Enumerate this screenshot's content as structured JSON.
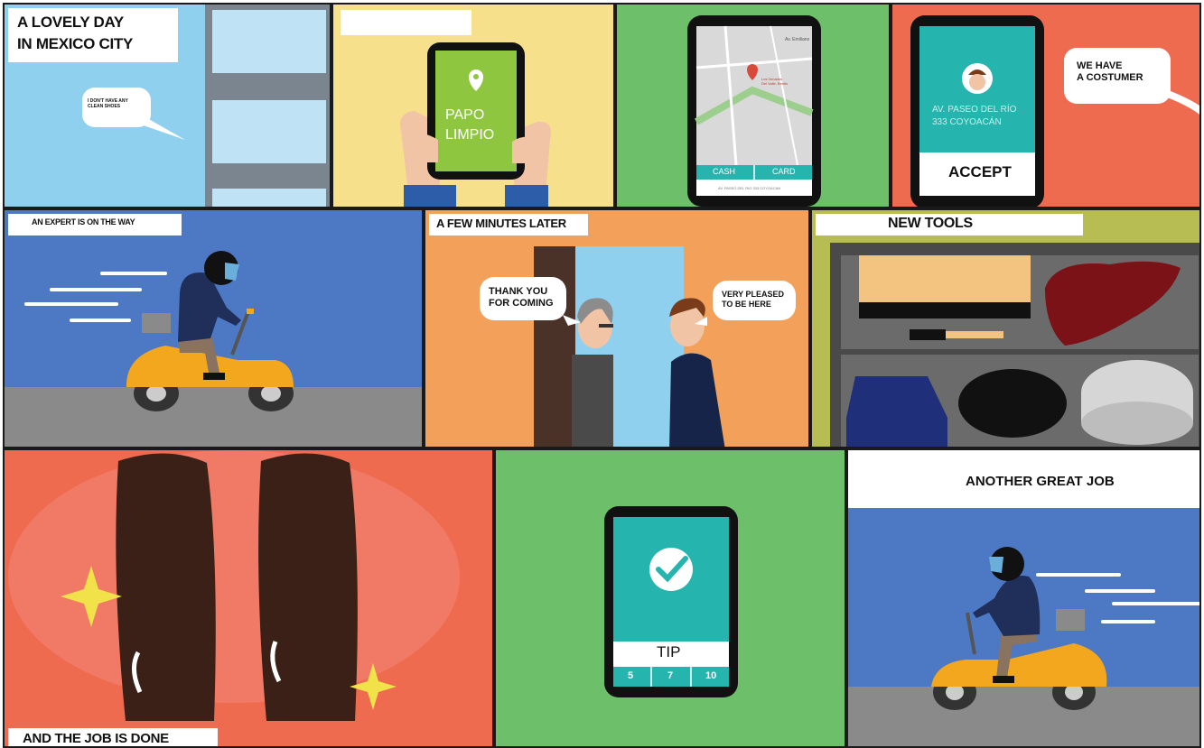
{
  "captions": {
    "p1": "A LOVELY DAY",
    "p1b": "IN MEXICO CITY",
    "p2": "",
    "p5": "AN EXPERT IS ON THE WAY",
    "p6": "A FEW MINUTES LATER",
    "p7": "NEW TOOLS",
    "p8": "AND THE JOB IS DONE",
    "p10": "ANOTHER GREAT JOB"
  },
  "bubbles": {
    "shoes_l1": "I DON'T HAVE ANY",
    "shoes_l2": "CLEAN SHOES",
    "customer_l1": "WE HAVE",
    "customer_l2": "A COSTUMER",
    "thanks_l1": "THANK YOU",
    "thanks_l2": "FOR COMING",
    "pleased_l1": "VERY PLEASED",
    "pleased_l2": "TO BE HERE"
  },
  "app": {
    "name_l1": "PAPO",
    "name_l2": "LIMPIO",
    "map_pin_l1": "Los Venados",
    "map_pin_l2": "Del Valle, Benito",
    "map_corner": "Av. Emiliano",
    "pay_cash": "CASH",
    "pay_card": "CARD",
    "map_footer": "AV. PASEO DEL RIO 333 COYOACAN",
    "address_l1": "AV. PASEO DEL RÍO",
    "address_l2": "333 COYOACÁN",
    "accept": "ACCEPT",
    "tip": "TIP",
    "tip_options": [
      "5",
      "7",
      "10"
    ]
  },
  "colors": {
    "sky": "#8fd0ef",
    "yellow": "#f7e08c",
    "green": "#6dbf6a",
    "coral": "#ef6b4f",
    "blue": "#4c78c4",
    "orange": "#f2a05a",
    "olive": "#b7bd52",
    "teal": "#25b4ae",
    "app_green": "#8ec63f"
  }
}
